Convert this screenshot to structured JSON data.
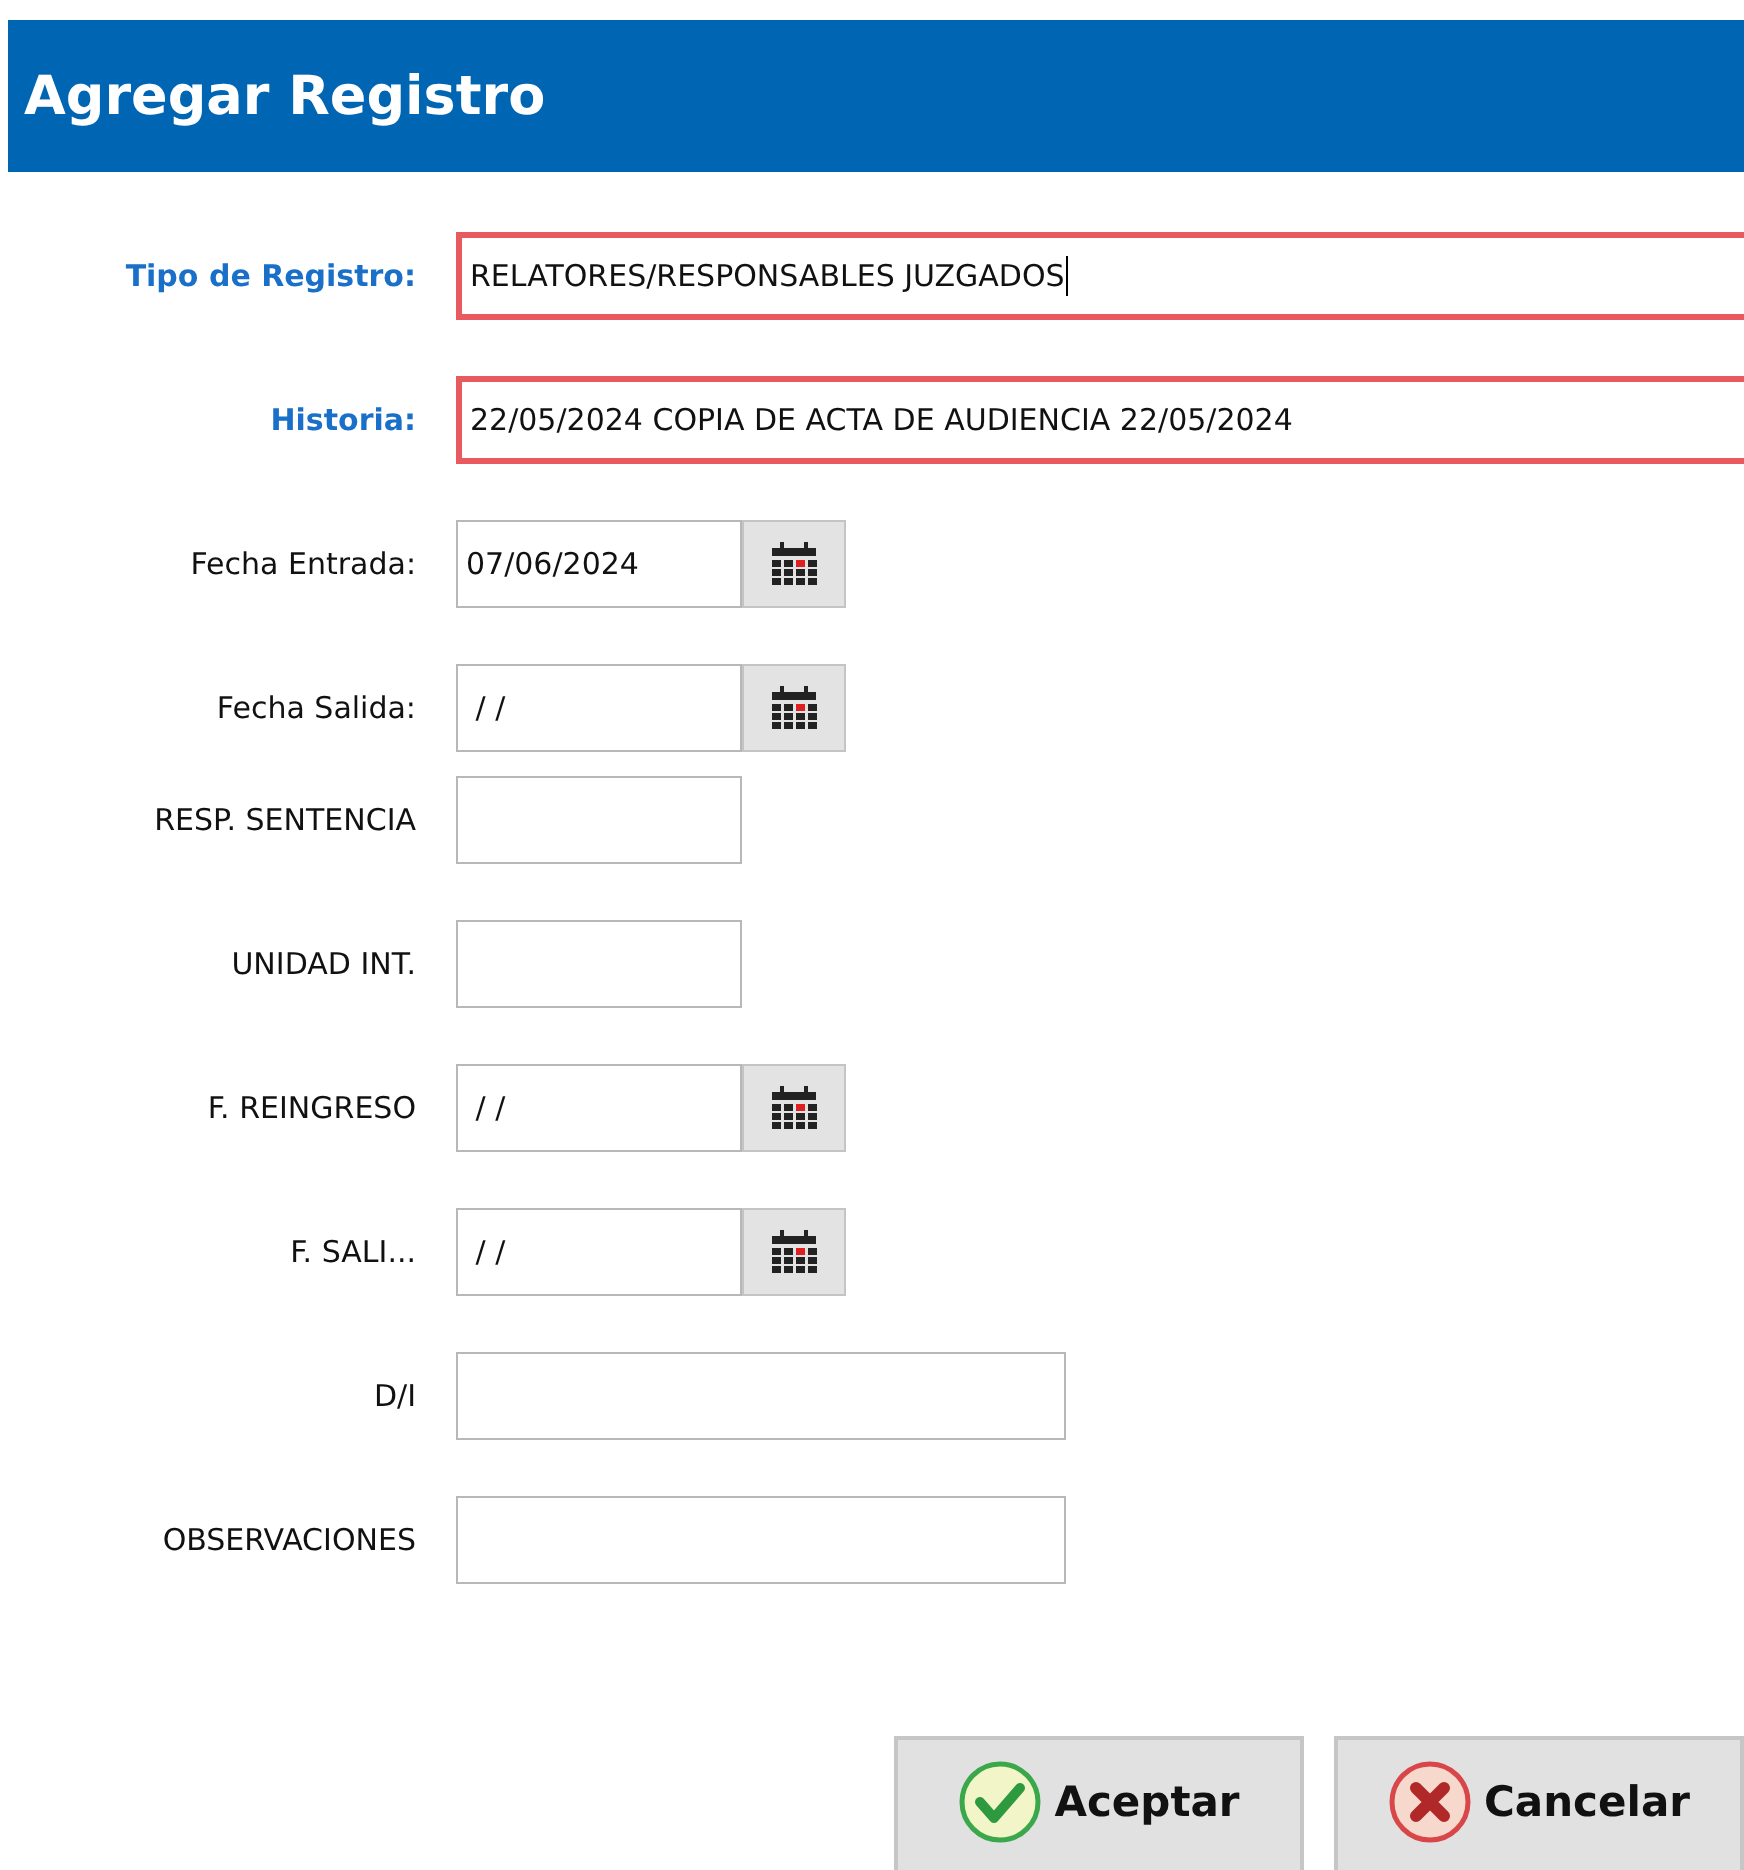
{
  "window": {
    "title": "Agregar Registro"
  },
  "fields": [
    {
      "label": "Tipo de Registro:",
      "kind": "required",
      "value": "RELATORES/RESPONSABLES JUZGADOS",
      "focused": true
    },
    {
      "label": "Historia:",
      "kind": "required",
      "value": "22/05/2024 COPIA DE ACTA DE AUDIENCIA 22/05/2024"
    },
    {
      "label": "Fecha Entrada:",
      "kind": "date",
      "value": "07/06/2024"
    },
    {
      "label": "Fecha Salida:",
      "kind": "date",
      "value": " / /"
    },
    {
      "label": "RESP. SENTENCIA",
      "kind": "short"
    },
    {
      "label": "UNIDAD INT.",
      "kind": "short"
    },
    {
      "label": "F. REINGRESO",
      "kind": "date",
      "value": " / /"
    },
    {
      "label": "F. SALI...",
      "kind": "date",
      "value": " / /"
    },
    {
      "label": "D/I",
      "kind": "long"
    },
    {
      "label": "OBSERVACIONES",
      "kind": "long"
    }
  ],
  "buttons": [
    {
      "label": "Aceptar",
      "kind": "ok"
    },
    {
      "label": "Cancelar",
      "kind": "cancel"
    }
  ]
}
